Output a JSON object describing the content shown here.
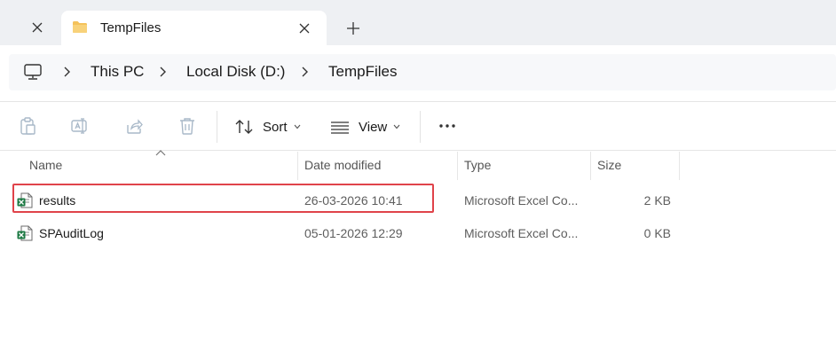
{
  "tabs": [
    {
      "title": "TempFiles",
      "icon": "folder-icon",
      "active": true
    }
  ],
  "breadcrumb": {
    "root_icon": "computer-icon",
    "items": [
      "This PC",
      "Local Disk (D:)",
      "TempFiles"
    ]
  },
  "commandbar": {
    "sort_label": "Sort",
    "view_label": "View",
    "icons": [
      "paste-icon",
      "rename-icon",
      "share-icon",
      "delete-icon",
      "sort-icon",
      "view-icon",
      "more-icon"
    ]
  },
  "columns": {
    "name": "Name",
    "date": "Date modified",
    "type": "Type",
    "size": "Size"
  },
  "files": [
    {
      "name": "results",
      "date": "26-03-2026 10:41",
      "type": "Microsoft Excel Co...",
      "size": "2 KB",
      "icon": "excel-icon",
      "highlighted": true
    },
    {
      "name": "SPAuditLog",
      "date": "05-01-2026 12:29",
      "type": "Microsoft Excel Co...",
      "size": "0 KB",
      "icon": "excel-icon",
      "highlighted": false
    }
  ],
  "colors": {
    "folder": "#f4c25b",
    "excel": "#1d7a44",
    "highlight": "#e0434a",
    "tabstrip_bg": "#eef0f3"
  }
}
